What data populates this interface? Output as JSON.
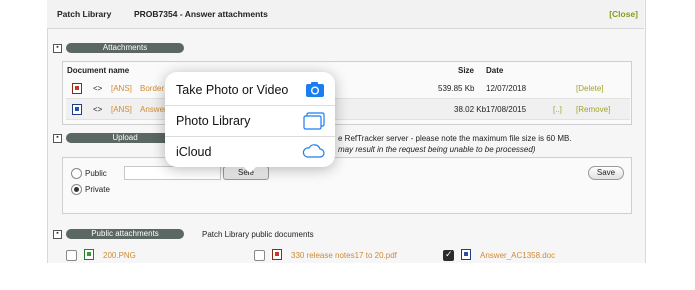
{
  "header": {
    "app": "Patch Library",
    "title": "PROB7354 - Answer attachments",
    "close": "[Close]"
  },
  "attachments": {
    "section": "Attachments",
    "toggle": "▪",
    "columns": {
      "name": "Document name",
      "size": "Size",
      "date": "Date"
    },
    "rows": [
      {
        "glyph": "<>",
        "tag": "[ANS]",
        "name": "Border",
        "size": "539.85 Kb",
        "date": "12/07/2018",
        "extra": "",
        "action": "[Delete]"
      },
      {
        "glyph": "<>",
        "tag": "[ANS]",
        "name": "Answer",
        "size": "38.02 Kb",
        "date": "17/08/2015",
        "extra": "[..]",
        "action": "[Remove]"
      }
    ]
  },
  "upload": {
    "section": "Upload",
    "info1": "e RefTracker server - please note the maximum file size is 60 MB.",
    "info2": "may result in the request being unable to be processed)",
    "public": "Public",
    "private": "Private",
    "select": "Sele",
    "save": "Save"
  },
  "public_attachments": {
    "section": "Public attachments",
    "subtitle": "Patch Library public documents",
    "files": [
      {
        "name": "200.PNG",
        "checked": false
      },
      {
        "name": "330 release notes17 to 20.pdf",
        "checked": false
      },
      {
        "name": "Answer_AC1358.doc",
        "checked": true
      }
    ]
  },
  "popover": {
    "items": [
      {
        "label": "Take Photo or Video",
        "icon": "camera-icon"
      },
      {
        "label": "Photo Library",
        "icon": "photo-library-icon"
      },
      {
        "label": "iCloud",
        "icon": "icloud-icon"
      }
    ],
    "accent": "#1a7df2"
  }
}
